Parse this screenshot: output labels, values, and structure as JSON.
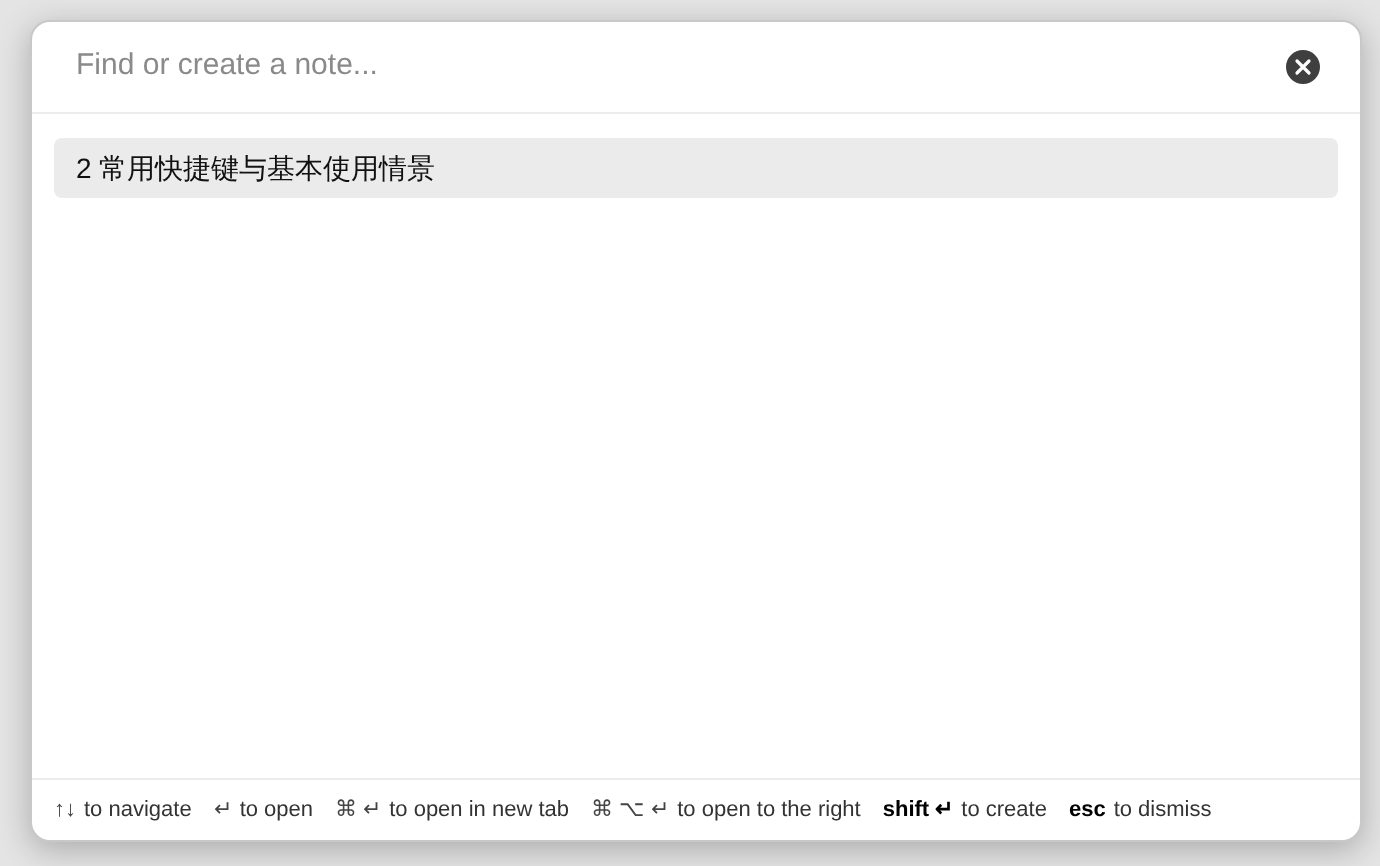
{
  "search": {
    "placeholder": "Find or create a note..."
  },
  "results": [
    {
      "title": "2 常用快捷键与基本使用情景",
      "selected": true
    }
  ],
  "hints": [
    {
      "keys": "↑↓",
      "action": "to navigate",
      "bold": false
    },
    {
      "keys": "↵",
      "action": "to open",
      "bold": false
    },
    {
      "keys": "⌘ ↵",
      "action": "to open in new tab",
      "bold": false
    },
    {
      "keys": "⌘ ⌥ ↵",
      "action": "to open to the right",
      "bold": false
    },
    {
      "keys": "shift ↵",
      "action": "to create",
      "bold": true
    },
    {
      "keys": "esc",
      "action": "to dismiss",
      "bold": true
    }
  ]
}
